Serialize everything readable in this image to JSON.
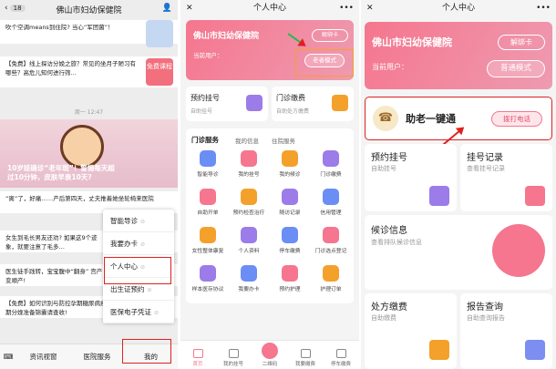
{
  "p1": {
    "badge": "18",
    "title": "佛山市妇幼保健院",
    "msg1": "吹个空调means到住院? 当心“军团菌”！",
    "msg2": "【免费】线上探访分娩之旅？常见的坐月子陋习有哪些？高危儿知何进行筛…",
    "thumb_label": "免费课程",
    "time": "周一 12:47",
    "banner_text": "10岁娃确诊“老年斑”！警惕每天超过10分钟，皮肤早衰10天?",
    "msg3": "“离”了，好痛……产后第四天，丈夫推着她坐轮椅来医院",
    "msg4": "女生到毛长男友还劝? 如果这9个迹象，就要注意了毛多…",
    "msg5": "医生徒手践转，宝宝腹中“翻身” 宫产变顺产!",
    "msg6": "【免费】如何识别与防控孕期糖尿病疾病？孕晚期分娩准备锦囊请查收!",
    "menu": [
      "智能导诊",
      "我要办卡",
      "个人中心",
      "出生证预约",
      "医保电子凭证"
    ],
    "nav": [
      "资讯视窗",
      "医院服务",
      "我的"
    ]
  },
  "p2": {
    "header": "个人中心",
    "hospital": "佛山市妇幼保健院",
    "unbind": "解绑卡",
    "current_user": "当前用户：",
    "elder_mode": "老者模式",
    "c1_title": "预约挂号",
    "c1_sub": "自助挂号",
    "c2_title": "门诊缴费",
    "c2_sub": "自助处方缴费",
    "tabs": [
      "门诊服务",
      "我的信息",
      "住院服务"
    ],
    "grid": [
      "智能导诊",
      "我的挂号",
      "我的候诊",
      "门诊缴费",
      "自助开单",
      "预约检查治疗",
      "随访记录",
      "信用管理",
      "女性整体康复",
      "个人资料",
      "停车缴费",
      "门诊选点登记",
      "样本医存协议",
      "我要办卡",
      "预约护理",
      "护理订单"
    ],
    "tabbar": [
      "首页",
      "我的挂号",
      "二维码",
      "我要缴费",
      "停车缴费"
    ]
  },
  "p3": {
    "header": "个人中心",
    "hospital": "佛山市妇幼保健院",
    "unbind": "解绑卡",
    "current_user": "当前用户：",
    "normal_mode": "普通模式",
    "elder_help": "助老一键通",
    "call": "拨打电话",
    "c1_title": "预约挂号",
    "c1_sub": "自助挂号",
    "c2_title": "挂号记录",
    "c2_sub": "查看挂号记录",
    "c3_title": "候诊信息",
    "c3_sub": "查看排队候诊信息",
    "c4_title": "处方缴费",
    "c4_sub": "自助缴费",
    "c5_title": "报告查询",
    "c5_sub": "自助查询报告"
  },
  "colors": {
    "pink": "#f5768e",
    "red": "#e02020",
    "orange": "#f3a12b"
  }
}
